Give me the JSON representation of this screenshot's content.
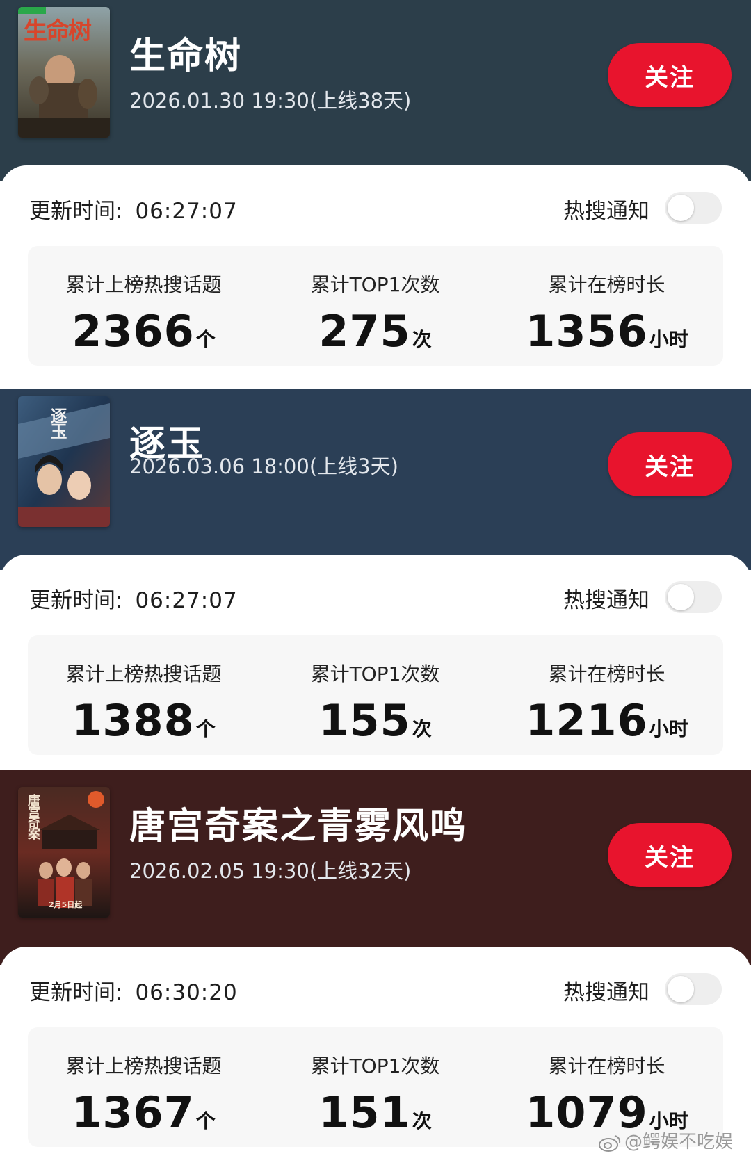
{
  "shows": [
    {
      "title": "生命树",
      "poster_icon": "poster-shengmingshu",
      "poster_text": "生命树",
      "release": "2026.01.30 19:30(上线38天)",
      "follow_label": "关注",
      "header_color": "#2c3e4a",
      "update_label": "更新时间:",
      "update_time": "06:27:07",
      "notify_label": "热搜通知",
      "notify_on": false,
      "stats": [
        {
          "label": "累计上榜热搜话题",
          "value": "2366",
          "unit": "个"
        },
        {
          "label": "累计TOP1次数",
          "value": "275",
          "unit": "次"
        },
        {
          "label": "累计在榜时长",
          "value": "1356",
          "unit": "小时"
        }
      ]
    },
    {
      "title": "逐玉",
      "poster_icon": "poster-zhuyu",
      "poster_text": "逐玉",
      "release": "2026.03.06 18:00(上线3天)",
      "follow_label": "关注",
      "header_color": "#2b3f56",
      "update_label": "更新时间:",
      "update_time": "06:27:07",
      "notify_label": "热搜通知",
      "notify_on": false,
      "stats": [
        {
          "label": "累计上榜热搜话题",
          "value": "1388",
          "unit": "个"
        },
        {
          "label": "累计TOP1次数",
          "value": "155",
          "unit": "次"
        },
        {
          "label": "累计在榜时长",
          "value": "1216",
          "unit": "小时"
        }
      ]
    },
    {
      "title": "唐宫奇案之青雾风鸣",
      "poster_icon": "poster-tanggong",
      "poster_text": "唐宫奇案",
      "poster_date": "2月5日起",
      "release": "2026.02.05 19:30(上线32天)",
      "follow_label": "关注",
      "header_color": "#3e1e1d",
      "update_label": "更新时间:",
      "update_time": "06:30:20",
      "notify_label": "热搜通知",
      "notify_on": false,
      "stats": [
        {
          "label": "累计上榜热搜话题",
          "value": "1367",
          "unit": "个"
        },
        {
          "label": "累计TOP1次数",
          "value": "151",
          "unit": "次"
        },
        {
          "label": "累计在榜时长",
          "value": "1079",
          "unit": "小时"
        }
      ]
    }
  ],
  "watermark": "@鳄娱不吃娱",
  "watermark_icon": "weibo-icon",
  "accent_color": "#e8142d"
}
